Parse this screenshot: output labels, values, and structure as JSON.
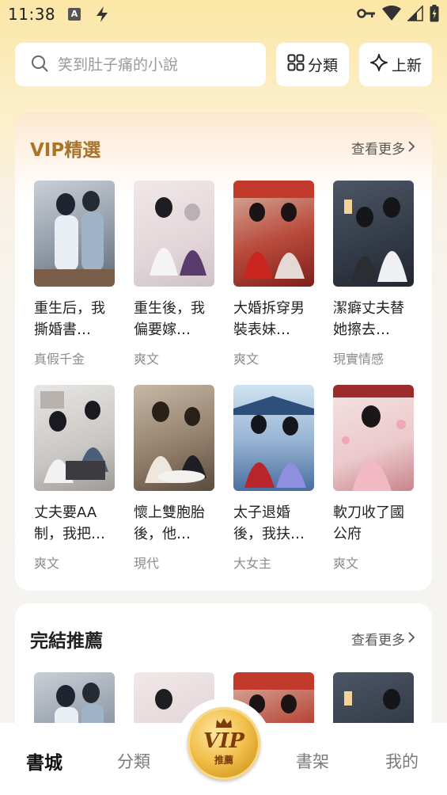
{
  "status_bar": {
    "time": "11:38",
    "a_label": "A"
  },
  "search": {
    "placeholder": "笑到肚子痛的小說"
  },
  "top_buttons": {
    "category": "分類",
    "new": "上新"
  },
  "vip_section": {
    "title": "VIP精選",
    "more": "查看更多",
    "books": [
      {
        "title": "重生后，我撕婚書…",
        "tag": "真假千金"
      },
      {
        "title": "重生後，我偏要嫁…",
        "tag": "爽文"
      },
      {
        "title": "大婚拆穿男裝表妹…",
        "tag": "爽文"
      },
      {
        "title": "潔癖丈夫替她擦去…",
        "tag": "現實情感"
      },
      {
        "title": "丈夫要AA制，我把…",
        "tag": "爽文"
      },
      {
        "title": "懷上雙胞胎後，他…",
        "tag": "現代"
      },
      {
        "title": "太子退婚後，我扶…",
        "tag": "大女主"
      },
      {
        "title": "軟刀收了國公府",
        "tag": "爽文"
      }
    ]
  },
  "completed_section": {
    "title": "完結推薦",
    "more": "查看更多"
  },
  "bottom_nav": {
    "bookstore": "書城",
    "category": "分類",
    "vip": "VIP",
    "vip_sub": "推薦",
    "shelf": "書架",
    "mine": "我的"
  },
  "colors": {
    "accent_gold": "#a8752a",
    "badge_gold": "#f2c04c"
  }
}
